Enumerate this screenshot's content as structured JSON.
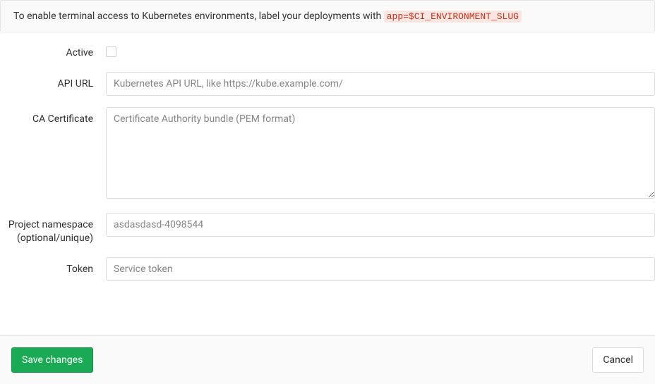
{
  "info": {
    "prefix_text": "To enable terminal access to Kubernetes environments, label your deployments with ",
    "code_text": "app=$CI_ENVIRONMENT_SLUG"
  },
  "form": {
    "active": {
      "label": "Active",
      "checked": false
    },
    "api_url": {
      "label": "API URL",
      "value": "",
      "placeholder": "Kubernetes API URL, like https://kube.example.com/"
    },
    "ca_certificate": {
      "label": "CA Certificate",
      "value": "",
      "placeholder": "Certificate Authority bundle (PEM format)"
    },
    "project_namespace": {
      "label": "Project namespace (optional/unique)",
      "value": "",
      "placeholder": "asdasdasd-4098544"
    },
    "token": {
      "label": "Token",
      "value": "",
      "placeholder": "Service token"
    }
  },
  "footer": {
    "save_label": "Save changes",
    "cancel_label": "Cancel"
  }
}
